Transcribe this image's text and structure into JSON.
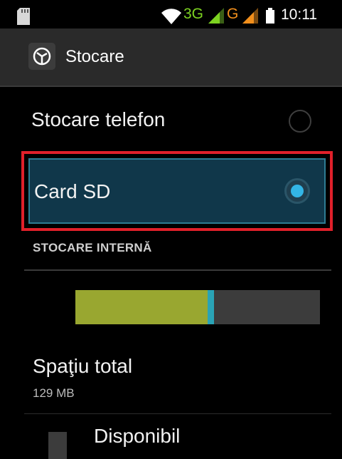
{
  "status_bar": {
    "network_3g": "3G",
    "network_g": "G",
    "time": "10:11",
    "icons": [
      "sd-card-icon",
      "wifi-icon",
      "signal-icon",
      "signal-icon",
      "battery-icon"
    ],
    "colors": {
      "net_3g": "#7dd321",
      "net_g": "#f28f1c"
    }
  },
  "action_bar": {
    "title": "Stocare",
    "icon": "storage-settings-icon"
  },
  "options": [
    {
      "label": "Stocare telefon",
      "selected": false
    },
    {
      "label": "Card SD",
      "selected": true
    }
  ],
  "section": {
    "header": "STOCARE INTERNĂ"
  },
  "usage": {
    "used_fraction": 0.54,
    "other_fraction": 0.025,
    "colors": {
      "used": "#99a730",
      "other": "#2aa3b5",
      "free": "#3c3c3c"
    }
  },
  "total": {
    "label": "Spaţiu total",
    "value": "129 MB"
  },
  "available": {
    "label": "Disponibil"
  },
  "highlight_color": "#e0202a",
  "accent_color": "#33b5e5"
}
